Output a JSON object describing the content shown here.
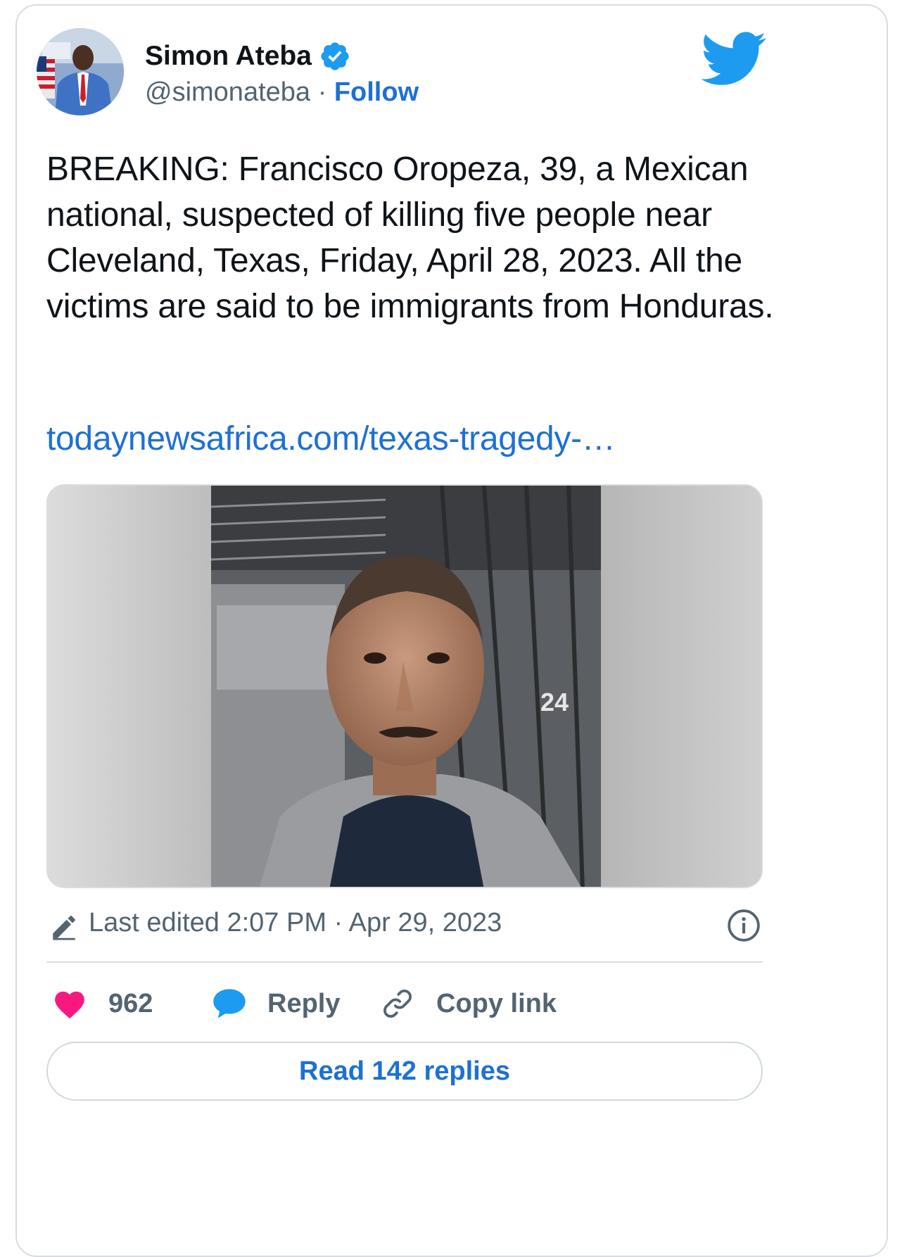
{
  "author": {
    "name": "Simon Ateba",
    "handle": "@simonateba",
    "separator": "·",
    "follow_label": "Follow",
    "verified": true
  },
  "tweet": {
    "text": "BREAKING: Francisco Oropeza, 39, a Mexican national, suspected of killing five people near Cleveland, Texas, Friday, April 28, 2023. All the victims are said to be immigrants from Honduras.",
    "link": "todaynewsafrica.com/texas-tragedy-…"
  },
  "media": {
    "photo_overlay_text": "24"
  },
  "meta": {
    "edited_text": "Last edited 2:07 PM · Apr 29, 2023"
  },
  "actions": {
    "likes": "962",
    "reply_label": "Reply",
    "copy_link_label": "Copy link"
  },
  "read_replies_label": "Read 142 replies",
  "colors": {
    "accent": "#1d70d6",
    "twitter_blue": "#1d9bf0",
    "like_pink": "#f91880",
    "secondary_text": "#536471",
    "border": "#d7dde2"
  },
  "icons": [
    "verified-badge-icon",
    "twitter-bird-icon",
    "edit-pencil-icon",
    "info-icon",
    "heart-icon",
    "reply-bubble-icon",
    "link-icon"
  ]
}
